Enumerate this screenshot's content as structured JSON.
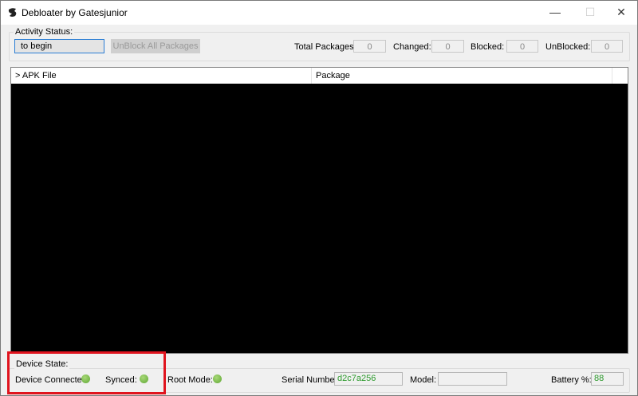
{
  "window": {
    "title": "Debloater by Gatesjunior",
    "minimize": "—",
    "maximize": "☐",
    "close": "✕"
  },
  "activity": {
    "group_label": "Activity Status:",
    "status_value": "to begin",
    "unblock_label": "UnBlock All Packages"
  },
  "counters": [
    {
      "label": "Total Packages:",
      "value": "0"
    },
    {
      "label": "Changed:",
      "value": "0"
    },
    {
      "label": "Blocked:",
      "value": "0"
    },
    {
      "label": "UnBlocked:",
      "value": "0"
    }
  ],
  "list": {
    "columns": [
      "> APK File",
      "Package"
    ]
  },
  "device": {
    "group_label": "Device State:",
    "connected_label": "Device Connected:",
    "synced_label": "Synced:",
    "root_label": "Root Mode:",
    "serial_label": "Serial Number:",
    "serial_value": "d2c7a256",
    "model_label": "Model:",
    "model_value": "",
    "battery_label": "Battery %:",
    "battery_value": "88",
    "indicator_color": "#6cb23f",
    "highlight_color": "#e0141e"
  }
}
